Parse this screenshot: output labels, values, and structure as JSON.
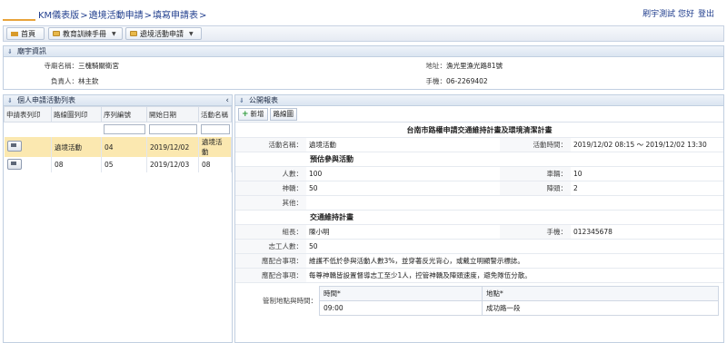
{
  "breadcrumb": {
    "home": "KM儀表版",
    "sep1": ">",
    "level2": "遶境活動申請",
    "sep2": ">",
    "level3": "填寫申請表",
    "sep3": ">"
  },
  "user": {
    "greeting": "刷宇測試 您好",
    "logout": "登出"
  },
  "toolbar": {
    "home": "首頁",
    "manual": "教育訓練手冊",
    "apply": "遶境活動申請"
  },
  "temple_panel": {
    "title": "廟宇資訊",
    "name_label": "寺廟名稱：",
    "name": "三槐騎關衛宮",
    "addr_label": "地址：",
    "addr": "漁光里漁光路81號",
    "owner_label": "負責人：",
    "owner": "林主欽",
    "phone_label": "手機：",
    "phone": "06-2269402"
  },
  "left_panel": {
    "title": "個人申請活動列表",
    "columns": [
      "申請表列印",
      "路線圖列印",
      "序列編號",
      "開始日期",
      "活動名稱"
    ],
    "rows": [
      {
        "seq": "04",
        "date": "2019/12/02",
        "route": "遶境活動",
        "name": "遶境活動"
      },
      {
        "seq": "05",
        "date": "2019/12/03",
        "route": "08",
        "name": "08"
      }
    ]
  },
  "right_panel": {
    "title": "公開報表",
    "add": "新增",
    "route": "路線圖",
    "form_title": "台南市路權申請交通維持計畫及環境清潔計畫",
    "act_name_label": "活動名稱：",
    "act_name": "遶境活動",
    "act_time_label": "活動時間：",
    "act_time": "2019/12/02 08:15 ～ 2019/12/02 13:30",
    "est_title": "預估參與活動",
    "people_label": "人數：",
    "people": "100",
    "cars_label": "車輛：",
    "cars": "10",
    "sedan_label": "神轎：",
    "sedan": "50",
    "troupe_label": "陣頭：",
    "troupe": "2",
    "other_label": "其他：",
    "other": "",
    "plan_title": "交通維持計畫",
    "leader_label": "組長：",
    "leader": "陳小明",
    "mobile_label": "手機：",
    "mobile": "012345678",
    "volunteers_label": "志工人數：",
    "volunteers": "50",
    "note1_label": "應配合事項：",
    "note1": "維護不低於參與活動人數3%，並穿著反光背心，或戴立明顯警示標誌。",
    "note2_label": "應配合事項：",
    "note2": "每尊神轎皆設置督導志工至少1人，控管神轎及陣頭速度，避免隊伍分散。",
    "control_label": "管制地點與時間：",
    "sub_cols": [
      "時間*",
      "地點*"
    ],
    "sub_rows": [
      {
        "time": "09:00",
        "place": "成功路一段"
      }
    ]
  }
}
